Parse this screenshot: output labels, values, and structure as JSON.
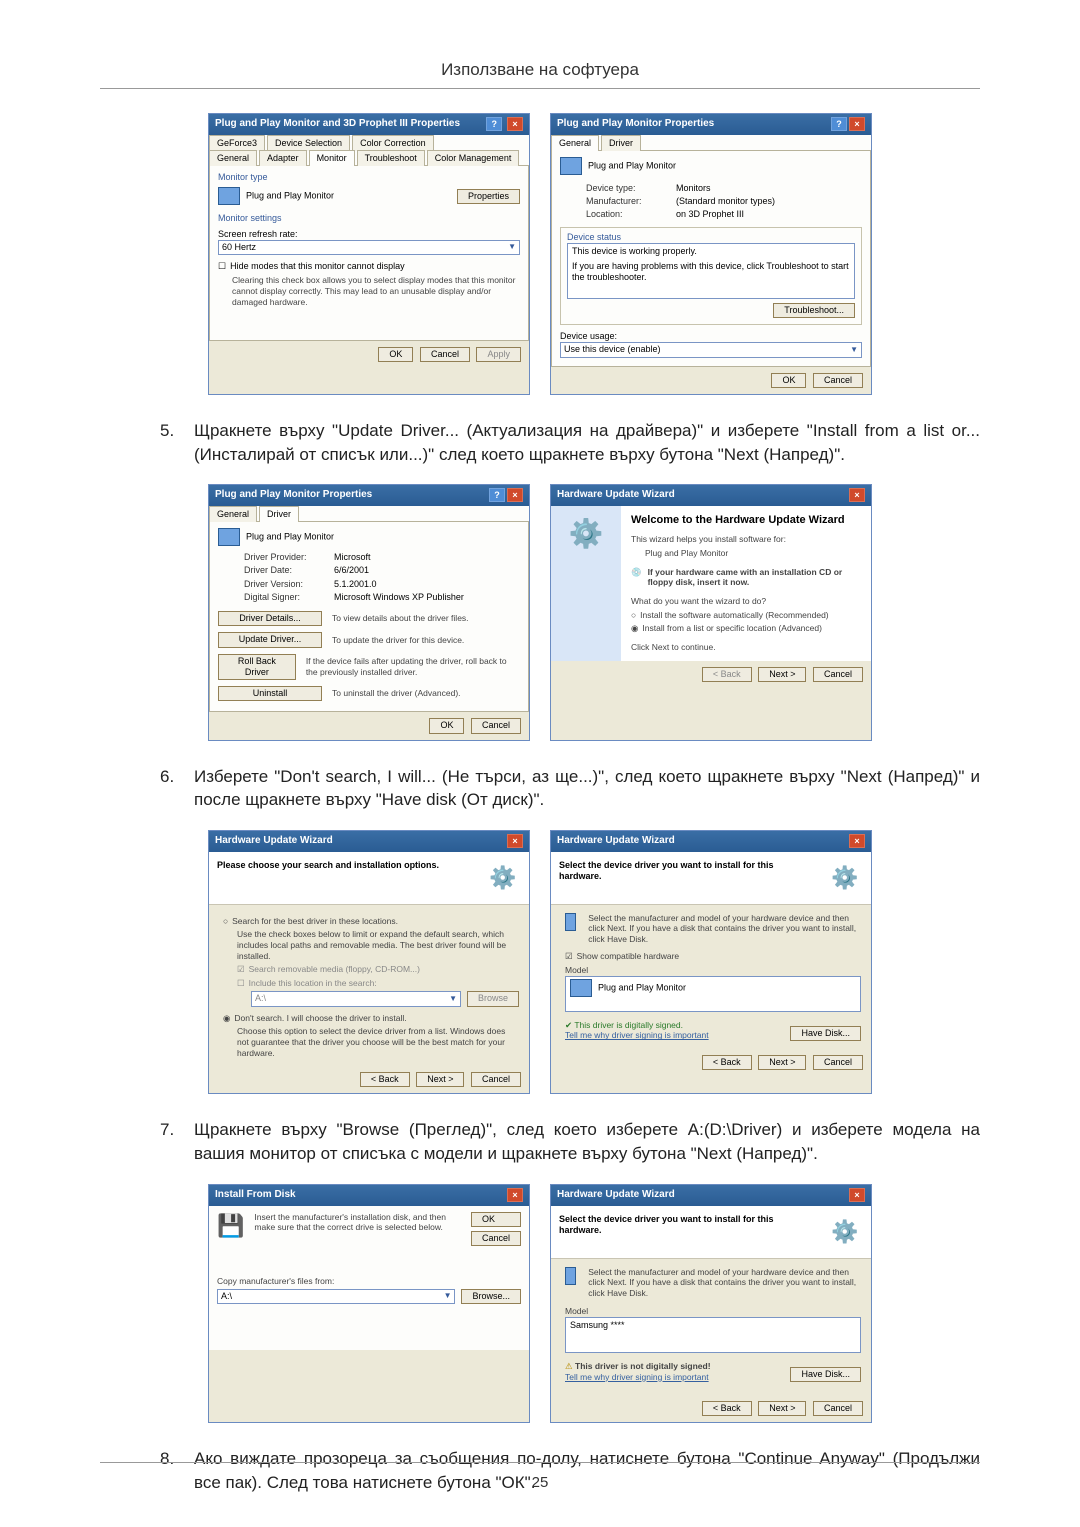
{
  "header": {
    "title": "Използване на софтуера"
  },
  "page_number": "25",
  "steps": {
    "s5": {
      "num": "5.",
      "text": "Щракнете върху \"Update Driver... (Актуализация на драйвера)\" и изберете \"Install from a list or... (Инсталирай от списък или...)\" след което щракнете върху бутона \"Next (Напред)\"."
    },
    "s6": {
      "num": "6.",
      "text": "Изберете \"Don't search, I will... (Не търси, аз ще...)\", след което щракнете върху \"Next (Напред)\" и после щракнете върху \"Have disk (От диск)\"."
    },
    "s7": {
      "num": "7.",
      "text": "Щракнете върху \"Browse (Преглед)\", след което изберете A:(D:\\Driver) и изберете модела на вашия монитор от списъка с модели и щракнете върху бутона \"Next (Напред)\"."
    },
    "s8": {
      "num": "8.",
      "text": "Ако виждате прозореца за съобщения по-долу, натиснете бутона \"Continue Anyway\" (Продължи все пак). След това натиснете бутона \"ОК\"."
    }
  },
  "dlg1": {
    "title": "Plug and Play Monitor and 3D Prophet III Properties",
    "tabs1": [
      "GeForce3",
      "Device Selection",
      "Color Correction"
    ],
    "tabs2": [
      "General",
      "Adapter",
      "Monitor",
      "Troubleshoot",
      "Color Management"
    ],
    "monitor_type_lbl": "Monitor type",
    "monitor_type_val": "Plug and Play Monitor",
    "properties_btn": "Properties",
    "monitor_settings_lbl": "Monitor settings",
    "refresh_lbl": "Screen refresh rate:",
    "refresh_val": "60 Hertz",
    "hide_modes_lbl": "Hide modes that this monitor cannot display",
    "hide_modes_desc": "Clearing this check box allows you to select display modes that this monitor cannot display correctly. This may lead to an unusable display and/or damaged hardware.",
    "ok": "OK",
    "cancel": "Cancel",
    "apply": "Apply"
  },
  "dlg2": {
    "title": "Plug and Play Monitor Properties",
    "tabs": [
      "General",
      "Driver"
    ],
    "pnp": "Plug and Play Monitor",
    "type_k": "Device type:",
    "type_v": "Monitors",
    "man_k": "Manufacturer:",
    "man_v": "(Standard monitor types)",
    "loc_k": "Location:",
    "loc_v": "on 3D Prophet III",
    "status_lbl": "Device status",
    "status_txt": "This device is working properly.",
    "status_help": "If you are having problems with this device, click Troubleshoot to start the troubleshooter.",
    "troubleshoot": "Troubleshoot...",
    "usage_lbl": "Device usage:",
    "usage_val": "Use this device (enable)",
    "ok": "OK",
    "cancel": "Cancel"
  },
  "dlg3": {
    "title": "Plug and Play Monitor Properties",
    "tabs": [
      "General",
      "Driver"
    ],
    "pnp": "Plug and Play Monitor",
    "prov_k": "Driver Provider:",
    "prov_v": "Microsoft",
    "date_k": "Driver Date:",
    "date_v": "6/6/2001",
    "ver_k": "Driver Version:",
    "ver_v": "5.1.2001.0",
    "sign_k": "Digital Signer:",
    "sign_v": "Microsoft Windows XP Publisher",
    "details_btn": "Driver Details...",
    "details_txt": "To view details about the driver files.",
    "update_btn": "Update Driver...",
    "update_txt": "To update the driver for this device.",
    "roll_btn": "Roll Back Driver",
    "roll_txt": "If the device fails after updating the driver, roll back to the previously installed driver.",
    "uninst_btn": "Uninstall",
    "uninst_txt": "To uninstall the driver (Advanced).",
    "ok": "OK",
    "cancel": "Cancel"
  },
  "dlg4": {
    "title": "Hardware Update Wizard",
    "welcome": "Welcome to the Hardware Update Wizard",
    "helps": "This wizard helps you install software for:",
    "device": "Plug and Play Monitor",
    "cd_txt": "If your hardware came with an installation CD or floppy disk, insert it now.",
    "what_do": "What do you want the wizard to do?",
    "opt_auto": "Install the software automatically (Recommended)",
    "opt_list": "Install from a list or specific location (Advanced)",
    "cont": "Click Next to continue.",
    "back": "< Back",
    "next": "Next >",
    "cancel": "Cancel"
  },
  "dlg5": {
    "title": "Hardware Update Wizard",
    "heading": "Please choose your search and installation options.",
    "opt_search": "Search for the best driver in these locations.",
    "opt_search_desc": "Use the check boxes below to limit or expand the default search, which includes local paths and removable media. The best driver found will be installed.",
    "chk_rem": "Search removable media (floppy, CD-ROM...)",
    "chk_loc": "Include this location in the search:",
    "loc_val": "A:\\",
    "browse": "Browse",
    "opt_dont": "Don't search. I will choose the driver to install.",
    "opt_dont_desc": "Choose this option to select the device driver from a list. Windows does not guarantee that the driver you choose will be the best match for your hardware.",
    "back": "< Back",
    "next": "Next >",
    "cancel": "Cancel"
  },
  "dlg6": {
    "title": "Hardware Update Wizard",
    "heading": "Select the device driver you want to install for this hardware.",
    "desc": "Select the manufacturer and model of your hardware device and then click Next. If you have a disk that contains the driver you want to install, click Have Disk.",
    "chk_compat": "Show compatible hardware",
    "model_lbl": "Model",
    "model_val": "Plug and Play Monitor",
    "signed_txt": "This driver is digitally signed.",
    "signed_link": "Tell me why driver signing is important",
    "have_disk": "Have Disk...",
    "back": "< Back",
    "next": "Next >",
    "cancel": "Cancel"
  },
  "dlg7": {
    "title": "Install From Disk",
    "desc": "Insert the manufacturer's installation disk, and then make sure that the correct drive is selected below.",
    "ok": "OK",
    "cancel": "Cancel",
    "copy_lbl": "Copy manufacturer's files from:",
    "path_val": "A:\\",
    "browse": "Browse..."
  },
  "dlg8": {
    "title": "Hardware Update Wizard",
    "heading": "Select the device driver you want to install for this hardware.",
    "desc": "Select the manufacturer and model of your hardware device and then click Next. If you have a disk that contains the driver you want to install, click Have Disk.",
    "model_lbl": "Model",
    "model_val": "Samsung ****",
    "not_signed": "This driver is not digitally signed!",
    "sign_link": "Tell me why driver signing is important",
    "have_disk": "Have Disk...",
    "back": "< Back",
    "next": "Next >",
    "cancel": "Cancel"
  }
}
